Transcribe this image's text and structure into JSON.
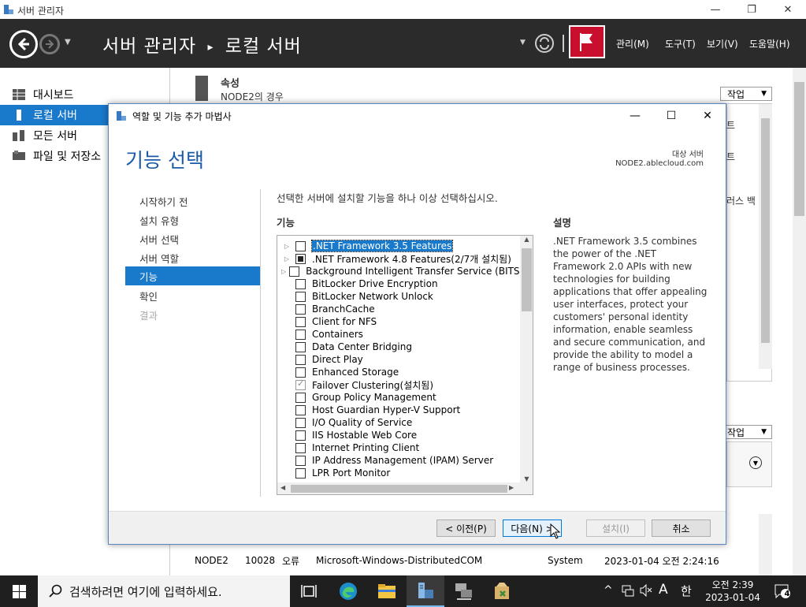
{
  "window": {
    "title": "서버 관리자",
    "minimize": "—",
    "restore": "❐",
    "close": "✕"
  },
  "header": {
    "breadcrumb_app": "서버 관리자",
    "breadcrumb_sep": "▸",
    "breadcrumb_page": "로컬 서버",
    "menus": [
      "관리(M)",
      "도구(T)",
      "보기(V)",
      "도움말(H)"
    ]
  },
  "sidebar": {
    "items": [
      {
        "label": "대시보드",
        "icon": "dashboard-icon"
      },
      {
        "label": "로컬 서버",
        "icon": "server-icon"
      },
      {
        "label": "모든 서버",
        "icon": "servers-icon"
      },
      {
        "label": "파일 및 저장소",
        "icon": "storage-icon"
      }
    ]
  },
  "background": {
    "props_title": "속성",
    "props_sub": "NODE2의 경우",
    "tasks_label": "작업",
    "right_fragments": [
      "트",
      "트",
      "러스 백"
    ],
    "event_row": {
      "server": "NODE2",
      "id": "10028",
      "severity": "오류",
      "source": "Microsoft-Windows-DistributedCOM",
      "log": "System",
      "date": "2023-01-04 오전 2:24:16"
    }
  },
  "dialog": {
    "title": "역할 및 기능 추가 마법사",
    "heading": "기능 선택",
    "dest_label": "대상 서버",
    "dest_value": "NODE2.ablecloud.com",
    "instruction": "선택한 서버에 설치할 기능을 하나 이상 선택하십시오.",
    "features_header": "기능",
    "description_header": "설명",
    "description": ".NET Framework 3.5 combines the power of the .NET Framework 2.0 APIs with new technologies for building applications that offer appealing user interfaces, protect your customers' personal identity information, enable seamless and secure communication, and provide the ability to model a range of business processes.",
    "steps": [
      {
        "label": "시작하기 전",
        "state": "normal"
      },
      {
        "label": "설치 유형",
        "state": "normal"
      },
      {
        "label": "서버 선택",
        "state": "normal"
      },
      {
        "label": "서버 역할",
        "state": "normal"
      },
      {
        "label": "기능",
        "state": "active"
      },
      {
        "label": "확인",
        "state": "normal"
      },
      {
        "label": "결과",
        "state": "disabled"
      }
    ],
    "features": [
      {
        "label": ".NET Framework 3.5 Features",
        "expandable": true,
        "state": "unchecked",
        "selected": true
      },
      {
        "label": ".NET Framework 4.8 Features(2/7개 설치됨)",
        "expandable": true,
        "state": "partial"
      },
      {
        "label": "Background Intelligent Transfer Service (BITS)",
        "expandable": true,
        "state": "unchecked"
      },
      {
        "label": "BitLocker Drive Encryption",
        "state": "unchecked"
      },
      {
        "label": "BitLocker Network Unlock",
        "state": "unchecked"
      },
      {
        "label": "BranchCache",
        "state": "unchecked"
      },
      {
        "label": "Client for NFS",
        "state": "unchecked"
      },
      {
        "label": "Containers",
        "state": "unchecked"
      },
      {
        "label": "Data Center Bridging",
        "state": "unchecked"
      },
      {
        "label": "Direct Play",
        "state": "unchecked"
      },
      {
        "label": "Enhanced Storage",
        "state": "unchecked"
      },
      {
        "label": "Failover Clustering(설치됨)",
        "state": "checked"
      },
      {
        "label": "Group Policy Management",
        "state": "unchecked"
      },
      {
        "label": "Host Guardian Hyper-V Support",
        "state": "unchecked"
      },
      {
        "label": "I/O Quality of Service",
        "state": "unchecked"
      },
      {
        "label": "IIS Hostable Web Core",
        "state": "unchecked"
      },
      {
        "label": "Internet Printing Client",
        "state": "unchecked"
      },
      {
        "label": "IP Address Management (IPAM) Server",
        "state": "unchecked"
      },
      {
        "label": "LPR Port Monitor",
        "state": "unchecked"
      }
    ],
    "buttons": {
      "prev": "< 이전(P)",
      "next": "다음(N) >",
      "install": "설치(I)",
      "cancel": "취소"
    }
  },
  "taskbar": {
    "search_placeholder": "검색하려면 여기에 입력하세요.",
    "apps": [
      "task-view-icon",
      "edge-icon",
      "file-explorer-icon",
      "server-manager-icon",
      "network-icon",
      "failover-cluster-icon"
    ],
    "ime_lang": "A",
    "ime_mode": "한",
    "clock_time": "오전 2:39",
    "clock_date": "2023-01-04",
    "notification_count": "4"
  },
  "colors": {
    "accent": "#1979ca",
    "header_bg": "#2b2b2b",
    "flag": "#c8102e",
    "dialog_heading": "#1a5aa6"
  }
}
